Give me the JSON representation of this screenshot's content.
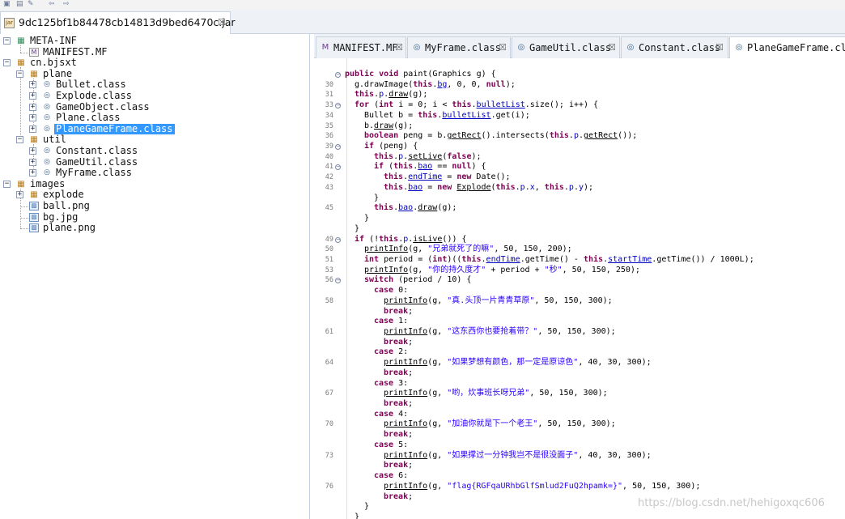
{
  "jar_tab": {
    "label": "9dc125bf1b84478cb14813d9bed6470c.jar",
    "close": "☒"
  },
  "tree": {
    "items": [
      {
        "label": "META-INF",
        "icon": "folder-icon",
        "expander": "⊟"
      },
      {
        "label": "MANIFEST.MF",
        "icon": "manifest-icon",
        "expander": ""
      },
      {
        "label": "cn.bjsxt",
        "icon": "package-icon",
        "expander": "⊟"
      },
      {
        "label": "plane",
        "icon": "package-icon",
        "expander": "⊟"
      },
      {
        "label": "Bullet.class",
        "icon": "class-file-icon",
        "expander": "⊞"
      },
      {
        "label": "Explode.class",
        "icon": "class-file-icon",
        "expander": "⊞"
      },
      {
        "label": "GameObject.class",
        "icon": "class-file-icon",
        "expander": "⊞"
      },
      {
        "label": "Plane.class",
        "icon": "class-file-icon",
        "expander": "⊞"
      },
      {
        "label": "PlaneGameFrame.class",
        "icon": "class-file-icon",
        "expander": "⊞",
        "selected": true
      },
      {
        "label": "util",
        "icon": "package-icon",
        "expander": "⊟"
      },
      {
        "label": "Constant.class",
        "icon": "class-file-icon",
        "expander": "⊞"
      },
      {
        "label": "GameUtil.class",
        "icon": "class-file-icon",
        "expander": "⊞"
      },
      {
        "label": "MyFrame.class",
        "icon": "class-file-icon",
        "expander": "⊞"
      },
      {
        "label": "images",
        "icon": "package-icon",
        "expander": "⊟"
      },
      {
        "label": "explode",
        "icon": "package-icon",
        "expander": "⊞"
      },
      {
        "label": "ball.png",
        "icon": "image-file-icon",
        "expander": ""
      },
      {
        "label": "bg.jpg",
        "icon": "image-file-icon",
        "expander": ""
      },
      {
        "label": "plane.png",
        "icon": "image-file-icon",
        "expander": ""
      }
    ]
  },
  "editor_tabs": [
    {
      "label": "MANIFEST.MF",
      "close": "☒",
      "icon": "manifest-icon"
    },
    {
      "label": "MyFrame.class",
      "close": "☒",
      "icon": "class-file-icon"
    },
    {
      "label": "GameUtil.class",
      "close": "☒",
      "icon": "class-file-icon"
    },
    {
      "label": "Constant.class",
      "close": "☒",
      "icon": "class-file-icon"
    },
    {
      "label": "PlaneGameFrame.cla",
      "close": "",
      "icon": "class-file-icon",
      "active": true
    }
  ],
  "code": {
    "lines": [
      {
        "num": "",
        "fold": true,
        "text": "public void paint(Graphics g) {"
      },
      {
        "num": "30",
        "fold": false,
        "text": "g.drawImage(this.bg, 0, 0, null);"
      },
      {
        "num": "31",
        "fold": false,
        "text": "this.p.draw(g);"
      },
      {
        "num": "33",
        "fold": true,
        "text": "for (int i = 0; i < this.bulletList.size(); i++) {"
      },
      {
        "num": "34",
        "fold": false,
        "text": "Bullet b = this.bulletList.get(i);"
      },
      {
        "num": "35",
        "fold": false,
        "text": "b.draw(g);"
      },
      {
        "num": "36",
        "fold": false,
        "text": "boolean peng = b.getRect().intersects(this.p.getRect());"
      },
      {
        "num": "39",
        "fold": true,
        "text": "if (peng) {"
      },
      {
        "num": "40",
        "fold": false,
        "text": "this.p.setLive(false);"
      },
      {
        "num": "41",
        "fold": true,
        "text": "if (this.bao == null) {"
      },
      {
        "num": "42",
        "fold": false,
        "text": "this.endTime = new Date();"
      },
      {
        "num": "43",
        "fold": false,
        "text": "this.bao = new Explode(this.p.x, this.p.y);"
      },
      {
        "num": "",
        "fold": false,
        "text": "}"
      },
      {
        "num": "45",
        "fold": false,
        "text": "this.bao.draw(g);"
      },
      {
        "num": "",
        "fold": false,
        "text": "}"
      },
      {
        "num": "",
        "fold": false,
        "text": "}"
      },
      {
        "num": "49",
        "fold": true,
        "text": "if (!this.p.isLive()) {"
      },
      {
        "num": "50",
        "fold": false,
        "text": "printInfo(g, \"兄弟就死了的嘛\", 50, 150, 200);"
      },
      {
        "num": "51",
        "fold": false,
        "text": "int period = (int)((this.endTime.getTime() - this.startTime.getTime()) / 1000L);"
      },
      {
        "num": "53",
        "fold": false,
        "text": "printInfo(g, \"你的持久度才\" + period + \"秒\", 50, 150, 250);"
      },
      {
        "num": "56",
        "fold": true,
        "text": "switch (period / 10) {"
      },
      {
        "num": "",
        "fold": false,
        "text": "case 0:"
      },
      {
        "num": "58",
        "fold": false,
        "text": "printInfo(g, \"真.头顶一片青青草原\", 50, 150, 300);"
      },
      {
        "num": "",
        "fold": false,
        "text": "break;"
      },
      {
        "num": "",
        "fold": false,
        "text": "case 1:"
      },
      {
        "num": "61",
        "fold": false,
        "text": "printInfo(g, \"这东西你也要抢着带？\", 50, 150, 300);"
      },
      {
        "num": "",
        "fold": false,
        "text": "break;"
      },
      {
        "num": "",
        "fold": false,
        "text": "case 2:"
      },
      {
        "num": "64",
        "fold": false,
        "text": "printInfo(g, \"如果梦想有颜色，那一定是原谅色\", 40, 30, 300);"
      },
      {
        "num": "",
        "fold": false,
        "text": "break;"
      },
      {
        "num": "",
        "fold": false,
        "text": "case 3:"
      },
      {
        "num": "67",
        "fold": false,
        "text": "printInfo(g, \"哟，炊事班长呀兄弟\", 50, 150, 300);"
      },
      {
        "num": "",
        "fold": false,
        "text": "break;"
      },
      {
        "num": "",
        "fold": false,
        "text": "case 4:"
      },
      {
        "num": "70",
        "fold": false,
        "text": "printInfo(g, \"加油你就是下一个老王\", 50, 150, 300);"
      },
      {
        "num": "",
        "fold": false,
        "text": "break;"
      },
      {
        "num": "",
        "fold": false,
        "text": "case 5:"
      },
      {
        "num": "73",
        "fold": false,
        "text": "printInfo(g, \"如果撑过一分钟我岂不是很没面子\", 40, 30, 300);"
      },
      {
        "num": "",
        "fold": false,
        "text": "break;"
      },
      {
        "num": "",
        "fold": false,
        "text": "case 6:"
      },
      {
        "num": "76",
        "fold": false,
        "text": "printInfo(g, \"flag{RGFqaURhbGlfSmlud2FuQ2hpamk=}\", 50, 150, 300);"
      },
      {
        "num": "",
        "fold": false,
        "text": "break;"
      },
      {
        "num": "",
        "fold": false,
        "text": "}"
      },
      {
        "num": "",
        "fold": false,
        "text": "}"
      }
    ]
  },
  "watermark": "https://blog.csdn.net/hehigoxqc606",
  "colors": {
    "keyword": "#7f0055",
    "string": "#2a00ff",
    "field": "#0000c0",
    "selection": "#3399ff"
  }
}
